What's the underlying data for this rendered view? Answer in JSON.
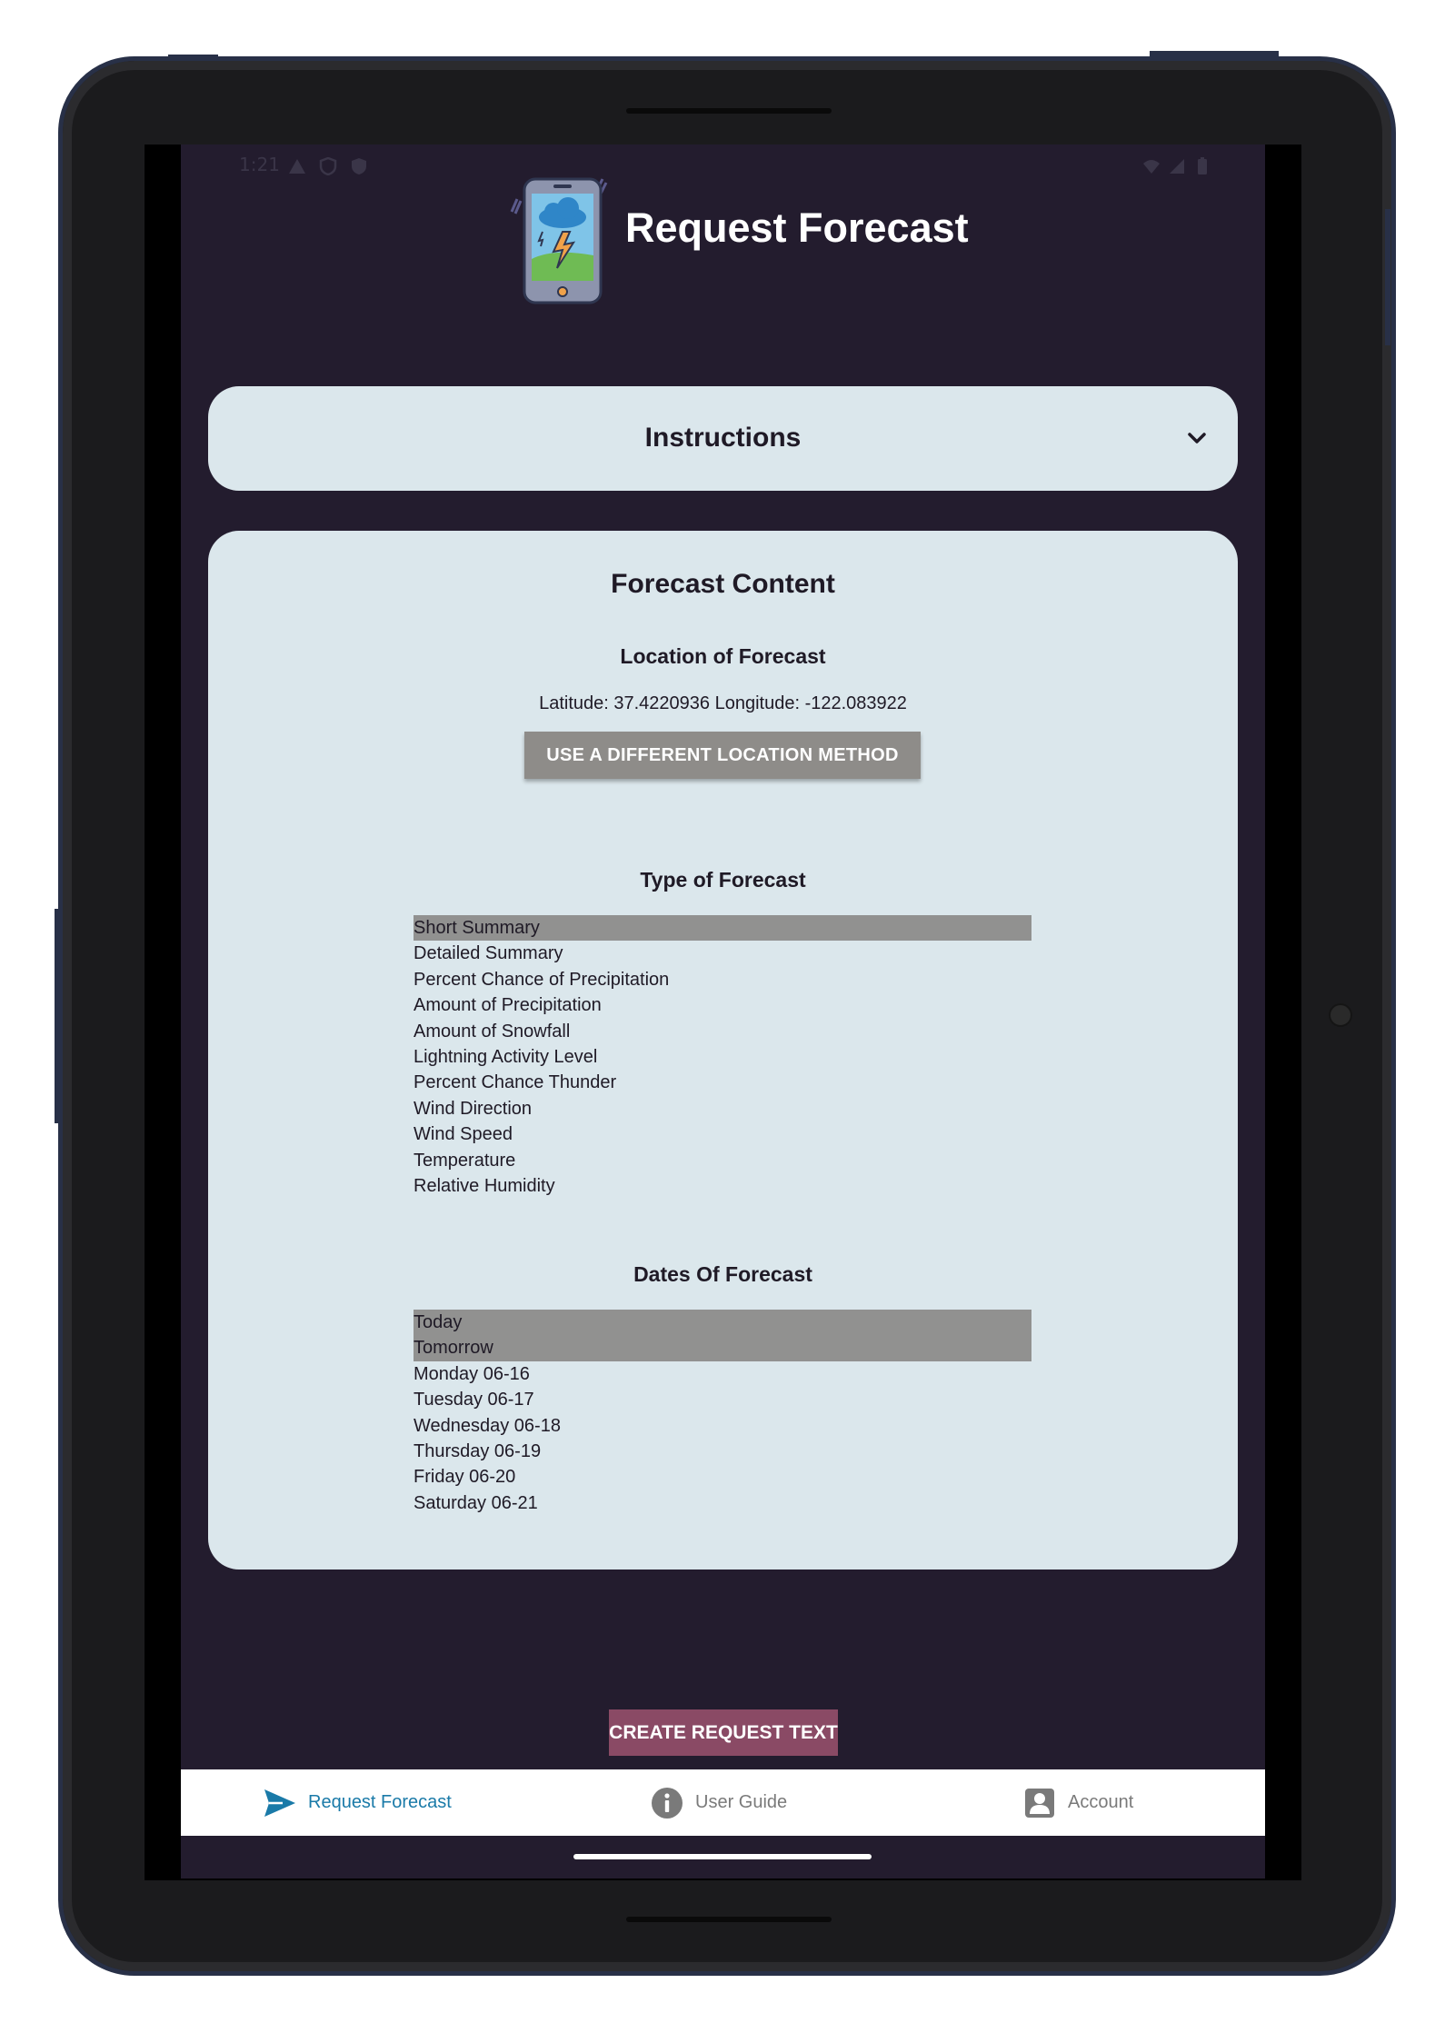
{
  "status_bar": {
    "time": "1:21"
  },
  "header": {
    "title": "Request Forecast"
  },
  "instructions": {
    "title": "Instructions"
  },
  "forecast_content": {
    "title": "Forecast Content",
    "location": {
      "heading": "Location of Forecast",
      "coords_text": "Latitude: 37.4220936 Longitude: -122.083922",
      "change_button": "USE A DIFFERENT LOCATION METHOD"
    },
    "type": {
      "heading": "Type of Forecast",
      "options": [
        {
          "label": "Short Summary",
          "selected": true
        },
        {
          "label": "Detailed Summary",
          "selected": false
        },
        {
          "label": "Percent Chance of Precipitation",
          "selected": false
        },
        {
          "label": "Amount of Precipitation",
          "selected": false
        },
        {
          "label": "Amount of Snowfall",
          "selected": false
        },
        {
          "label": "Lightning Activity Level",
          "selected": false
        },
        {
          "label": "Percent Chance Thunder",
          "selected": false
        },
        {
          "label": "Wind Direction",
          "selected": false
        },
        {
          "label": "Wind Speed",
          "selected": false
        },
        {
          "label": "Temperature",
          "selected": false
        },
        {
          "label": "Relative Humidity",
          "selected": false
        }
      ]
    },
    "dates": {
      "heading": "Dates Of Forecast",
      "options": [
        {
          "label": "Today",
          "selected": true
        },
        {
          "label": "Tomorrow",
          "selected": true
        },
        {
          "label": "Monday 06-16",
          "selected": false
        },
        {
          "label": "Tuesday 06-17",
          "selected": false
        },
        {
          "label": "Wednesday 06-18",
          "selected": false
        },
        {
          "label": "Thursday 06-19",
          "selected": false
        },
        {
          "label": "Friday 06-20",
          "selected": false
        },
        {
          "label": "Saturday 06-21",
          "selected": false
        }
      ]
    }
  },
  "create_button": "CREATE REQUEST TEXT",
  "bottom_nav": [
    {
      "label": "Request Forecast",
      "icon": "send-icon",
      "active": true
    },
    {
      "label": "User Guide",
      "icon": "info-icon",
      "active": false
    },
    {
      "label": "Account",
      "icon": "account-icon",
      "active": false
    }
  ],
  "colors": {
    "app_background": "#231c2e",
    "card_background": "#dbe7ec",
    "selected_row": "#919190",
    "location_button": "#8e8c89",
    "create_button": "#8a4a65",
    "nav_active": "#1a7aa8",
    "nav_inactive": "#7a7a7a"
  }
}
